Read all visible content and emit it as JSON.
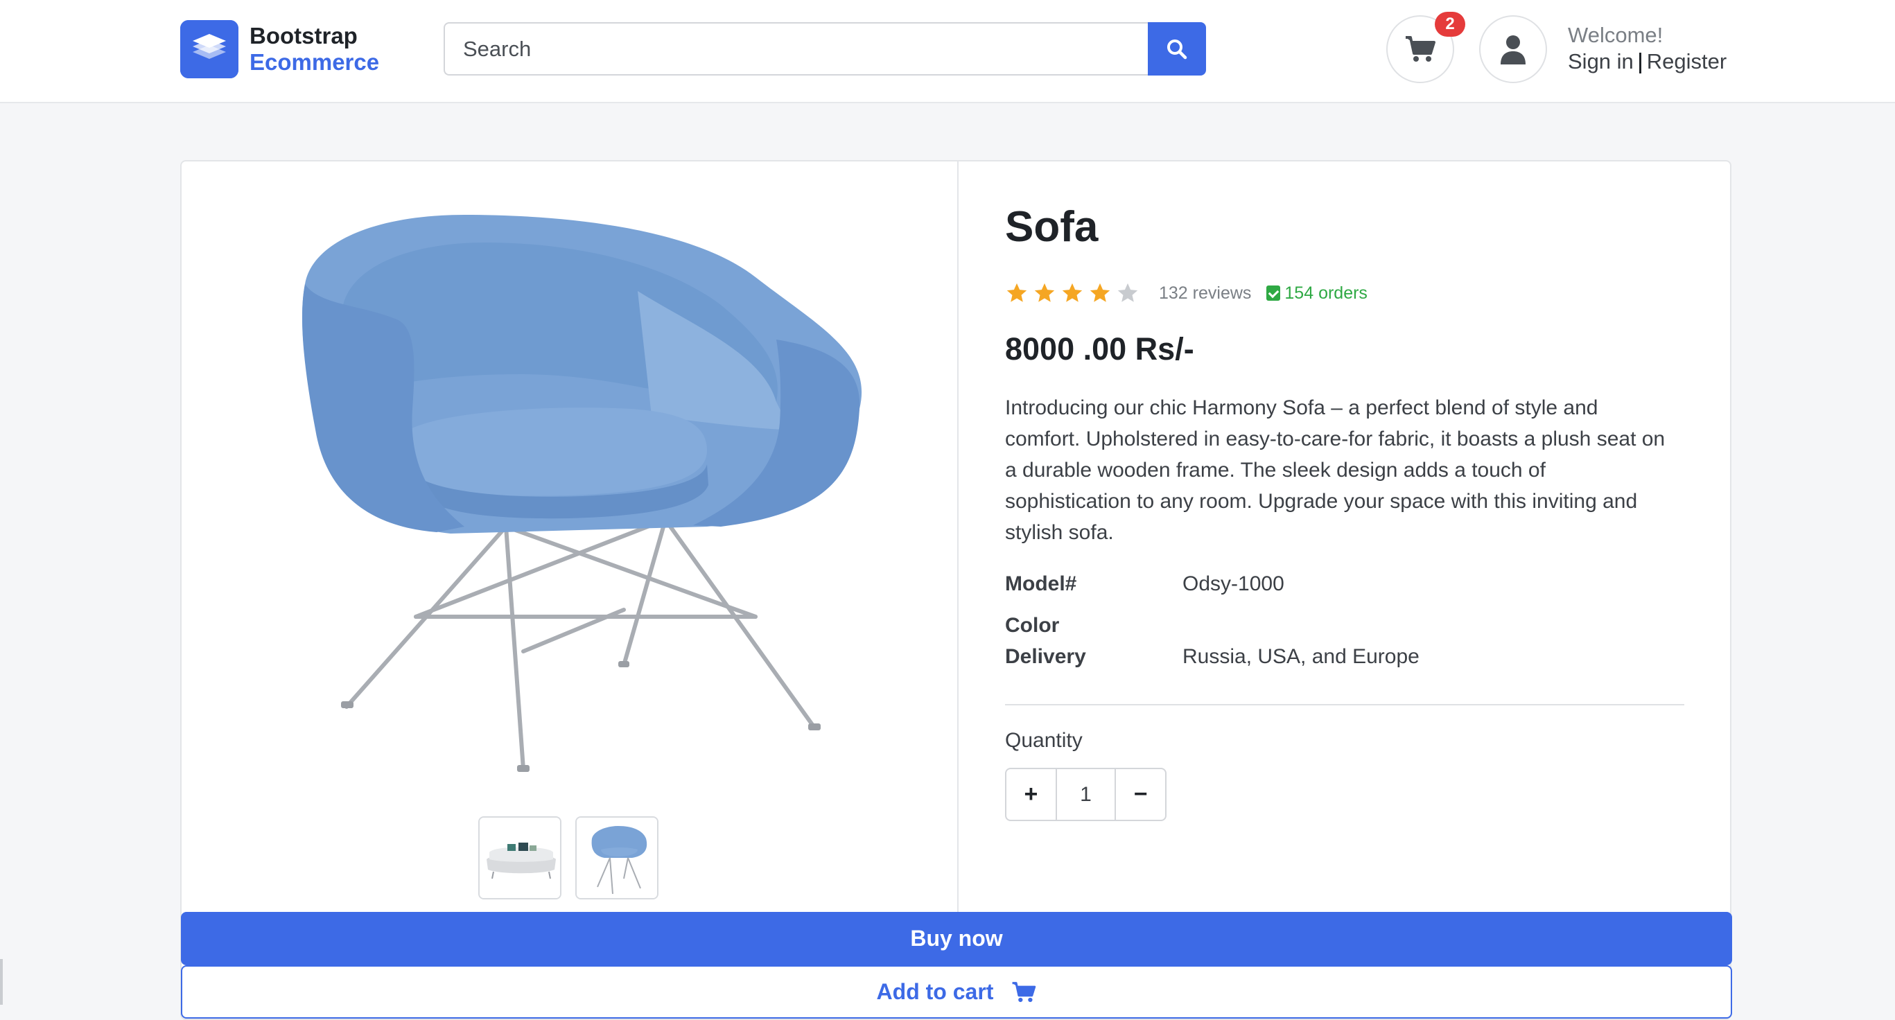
{
  "header": {
    "brand": {
      "line1": "Bootstrap",
      "line2": "Ecommerce"
    },
    "search": {
      "placeholder": "Search"
    },
    "cart_count": "2",
    "welcome": {
      "greeting": "Welcome!",
      "sign_in": "Sign in",
      "register": "Register"
    }
  },
  "product": {
    "title": "Sofa",
    "rating": {
      "stars": 4,
      "max": 5,
      "reviews": "132 reviews",
      "orders": "154 orders"
    },
    "price": "8000 .00 Rs/-",
    "description": "Introducing our chic Harmony Sofa – a perfect blend of style and comfort. Upholstered in easy-to-care-for fabric, it boasts a plush seat on a durable wooden frame. The sleek design adds a touch of sophistication to any room. Upgrade your space with this inviting and stylish sofa.",
    "specs": [
      {
        "label": "Model#",
        "value": "Odsy-1000"
      },
      {
        "label": "Color",
        "value": ""
      },
      {
        "label": "Delivery",
        "value": "Russia, USA, and Europe"
      }
    ],
    "quantity": {
      "label": "Quantity",
      "value": "1",
      "plus": "+",
      "minus": "−"
    },
    "buy_now": "Buy now",
    "add_to_cart": "Add to cart"
  },
  "colors": {
    "accent": "#3d6ae6",
    "badge": "#e53b3b",
    "star": "#f5a623",
    "orders_green": "#2fa944",
    "chair_blue": "#7aa3d6"
  },
  "icons": [
    "search-icon",
    "cart-icon",
    "user-icon",
    "star-icon",
    "check-icon"
  ]
}
